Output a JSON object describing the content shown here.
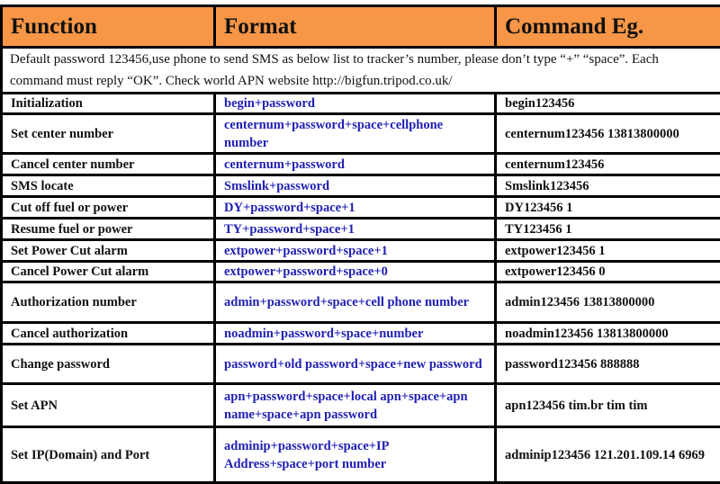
{
  "headers": {
    "function": "Function",
    "format": "Format",
    "example": "Command Eg."
  },
  "note": "Default password 123456,use phone to send SMS as below list to tracker’s number, please don’t type “+” “space”. Each command must reply “OK”. Check world APN website http://bigfun.tripod.co.uk/",
  "colors": {
    "header_bg": "#f79646",
    "format_text": "#1f1fb4"
  },
  "rows": [
    {
      "function": "Initialization",
      "format": "begin+password",
      "example": "begin123456"
    },
    {
      "function": "Set center number",
      "format": "centernum+password+space+cellphone number",
      "example": "centernum123456 13813800000"
    },
    {
      "function": "Cancel center number",
      "format": "centernum+password",
      "example": "centernum123456"
    },
    {
      "function": "SMS locate",
      "format": "Smslink+password",
      "example": "Smslink123456"
    },
    {
      "function": "Cut off fuel or power",
      "format": "DY+password+space+1",
      "example": "DY123456 1"
    },
    {
      "function": "Resume fuel or power",
      "format": "TY+password+space+1",
      "example": "TY123456 1"
    },
    {
      "function": "Set Power Cut alarm",
      "format": "extpower+password+space+1",
      "example": "extpower123456 1"
    },
    {
      "function": "Cancel Power Cut alarm",
      "format": "extpower+password+space+0",
      "example": "extpower123456 0"
    },
    {
      "function": "Authorization number",
      "format": "admin+password+space+cell phone number",
      "example": "admin123456 13813800000"
    },
    {
      "function": "Cancel authorization",
      "format": "noadmin+password+space+number",
      "example": "noadmin123456 13813800000"
    },
    {
      "function": "Change password",
      "format": "password+old password+space+new password",
      "example": "password123456 888888"
    },
    {
      "function": "Set APN",
      "format": "apn+password+space+local apn+space+apn name+space+apn password",
      "example": "apn123456 tim.br tim tim"
    },
    {
      "function": "Set IP(Domain) and Port",
      "format": "adminip+password+space+IP Address+space+port number",
      "example": "adminip123456 121.201.109.14 6969"
    }
  ]
}
